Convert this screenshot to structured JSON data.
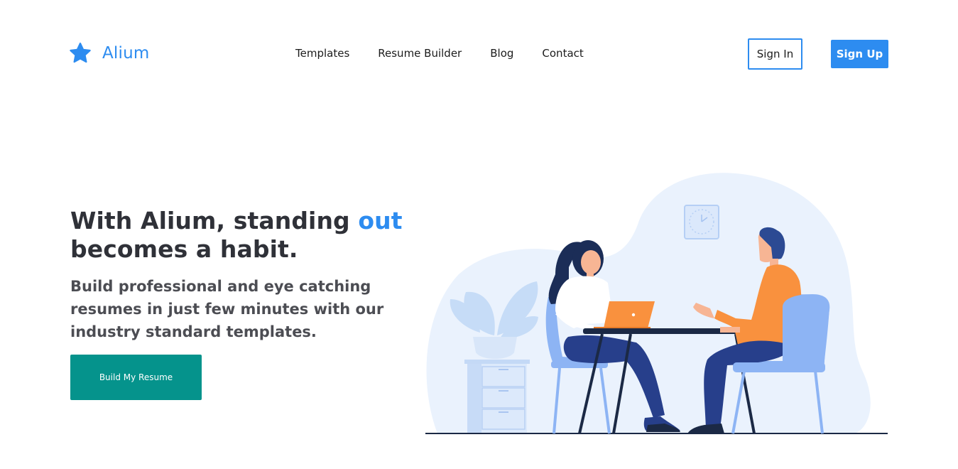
{
  "brand": {
    "name": "Alium",
    "logo_icon": "star-icon",
    "accent_color": "#2d8cf0"
  },
  "nav": {
    "items": [
      {
        "label": "Templates"
      },
      {
        "label": "Resume Builder"
      },
      {
        "label": "Blog"
      },
      {
        "label": "Contact"
      }
    ]
  },
  "auth": {
    "sign_in_label": "Sign In",
    "sign_up_label": "Sign Up"
  },
  "hero": {
    "title_pre": "With Alium, standing ",
    "title_accent": "out",
    "title_post": "becomes a habit.",
    "subtitle": "Build professional and eye catching resumes in just few minutes with our industry standard templates.",
    "cta_label": "Build My Resume",
    "cta_color": "#05938c"
  },
  "illustration": {
    "icon": "interview-illustration",
    "colors": {
      "blob": "#eaf2fd",
      "chair": "#8db4f4",
      "shirt_orange": "#f9913e",
      "pants_navy": "#273f8b",
      "table": "#1b2945",
      "laptop": "#f9913e"
    }
  }
}
